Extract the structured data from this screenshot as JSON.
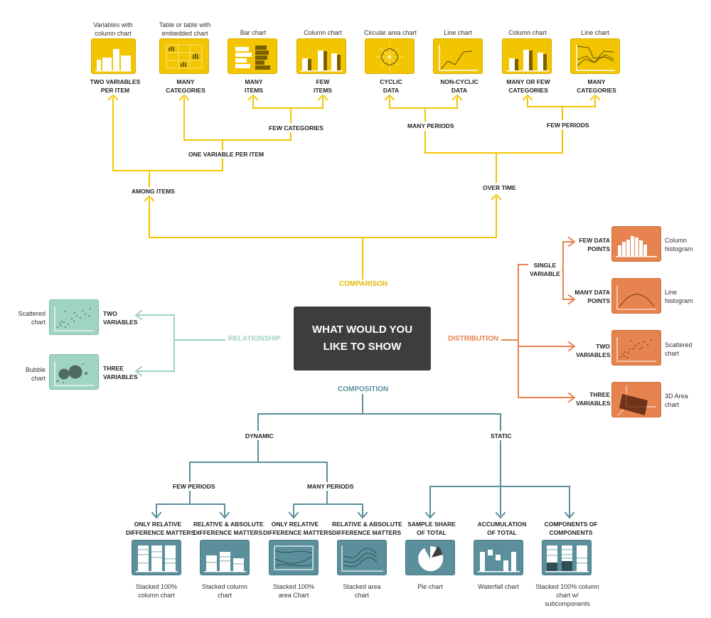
{
  "center": {
    "line1": "WHAT WOULD YOU",
    "line2": "LIKE TO SHOW"
  },
  "colors": {
    "comparison": "#f2c500",
    "distribution": "#e6834f",
    "relationship": "#9fd3c4",
    "composition": "#5b8f9c",
    "center": "#3d3d3d"
  },
  "categories": {
    "comparison": "COMPARISON",
    "distribution": "DISTRIBUTION",
    "relationship": "RELATIONSHIP",
    "composition": "COMPOSITION"
  },
  "comparison": {
    "branches": {
      "among_items": "AMONG ITEMS",
      "over_time": "OVER TIME",
      "one_variable": "ONE VARIABLE PER ITEM",
      "few_categories": "FEW CATEGORIES",
      "many_periods": "MANY PERIODS",
      "few_periods": "FEW PERIODS"
    },
    "leaves": [
      {
        "chart": [
          "Variables with",
          "column chart"
        ],
        "condition": [
          "TWO VARIABLES",
          "PER ITEM"
        ],
        "icon": "variable-width-column-icon"
      },
      {
        "chart": [
          "Table or table with",
          "embedded chart"
        ],
        "condition": [
          "MANY",
          "CATEGORIES"
        ],
        "icon": "table-embedded-chart-icon"
      },
      {
        "chart": [
          "Bar chart",
          ""
        ],
        "condition": [
          "MANY",
          "ITEMS"
        ],
        "icon": "bar-chart-icon"
      },
      {
        "chart": [
          "Column chart",
          ""
        ],
        "condition": [
          "FEW",
          "ITEMS"
        ],
        "icon": "column-chart-icon"
      },
      {
        "chart": [
          "Circular area chart",
          ""
        ],
        "condition": [
          "CYCLIC",
          "DATA"
        ],
        "icon": "circular-area-chart-icon"
      },
      {
        "chart": [
          "Line chart",
          ""
        ],
        "condition": [
          "NON-CYCLIC",
          "DATA"
        ],
        "icon": "line-chart-icon"
      },
      {
        "chart": [
          "Column chart",
          ""
        ],
        "condition": [
          "MANY OR FEW",
          "CATEGORIES"
        ],
        "icon": "column-chart-icon"
      },
      {
        "chart": [
          "Line chart",
          ""
        ],
        "condition": [
          "MANY",
          "CATEGORIES"
        ],
        "icon": "multi-line-chart-icon"
      }
    ]
  },
  "distribution": {
    "single_variable": [
      "SINGLE",
      "VARIABLE"
    ],
    "leaves": [
      {
        "condition": [
          "FEW DATA",
          "POINTS"
        ],
        "chart": [
          "Column",
          "histogram"
        ],
        "icon": "column-histogram-icon"
      },
      {
        "condition": [
          "MANY DATA",
          "POINTS"
        ],
        "chart": [
          "Line",
          "histogram"
        ],
        "icon": "line-histogram-icon"
      },
      {
        "condition": [
          "TWO",
          "VARIABLES"
        ],
        "chart": [
          "Scattered",
          "chart"
        ],
        "icon": "scatter-chart-icon"
      },
      {
        "condition": [
          "THREE",
          "VARIABLES"
        ],
        "chart": [
          "3D Area",
          "chart"
        ],
        "icon": "3d-area-chart-icon"
      }
    ]
  },
  "relationship": {
    "leaves": [
      {
        "condition": [
          "TWO",
          "VARIABLES"
        ],
        "chart": [
          "Scattered",
          "chart"
        ],
        "icon": "scatter-chart-icon"
      },
      {
        "condition": [
          "THREE",
          "VARIABLES"
        ],
        "chart": [
          "Bubble",
          "chart"
        ],
        "icon": "bubble-chart-icon"
      }
    ]
  },
  "composition": {
    "branches": {
      "dynamic": "DYNAMIC",
      "static": "STATIC",
      "few_periods": "FEW PERIODS",
      "many_periods": "MANY PERIODS"
    },
    "leaves": [
      {
        "condition": [
          "ONLY RELATIVE",
          "DIFFERENCE MATTERS"
        ],
        "chart": [
          "Stacked 100%",
          "column chart"
        ],
        "icon": "stacked-100-column-icon"
      },
      {
        "condition": [
          "RELATIVE & ABSOLUTE",
          "DIFFERENCE MATTERS"
        ],
        "chart": [
          "Stacked column",
          "chart"
        ],
        "icon": "stacked-column-icon"
      },
      {
        "condition": [
          "ONLY RELATIVE",
          "DIFFERENCE MATTERS"
        ],
        "chart": [
          "Stacked 100%",
          "area Chart"
        ],
        "icon": "stacked-100-area-icon"
      },
      {
        "condition": [
          "RELATIVE & ABSOLUTE",
          "DIFFERENCE MATTERS"
        ],
        "chart": [
          "Stacked area",
          "chart"
        ],
        "icon": "stacked-area-icon"
      },
      {
        "condition": [
          "SAMPLE SHARE",
          "OF TOTAL"
        ],
        "chart": [
          "Pie chart",
          ""
        ],
        "icon": "pie-chart-icon"
      },
      {
        "condition": [
          "ACCUMULATION",
          "OF TOTAL"
        ],
        "chart": [
          "Waterfall chart",
          ""
        ],
        "icon": "waterfall-chart-icon"
      },
      {
        "condition": [
          "COMPONENTS OF",
          "COMPONENTS"
        ],
        "chart": [
          "Stacked 100% column",
          "chart w/ subcomponents"
        ],
        "icon": "stacked-subcomponents-icon"
      }
    ]
  }
}
